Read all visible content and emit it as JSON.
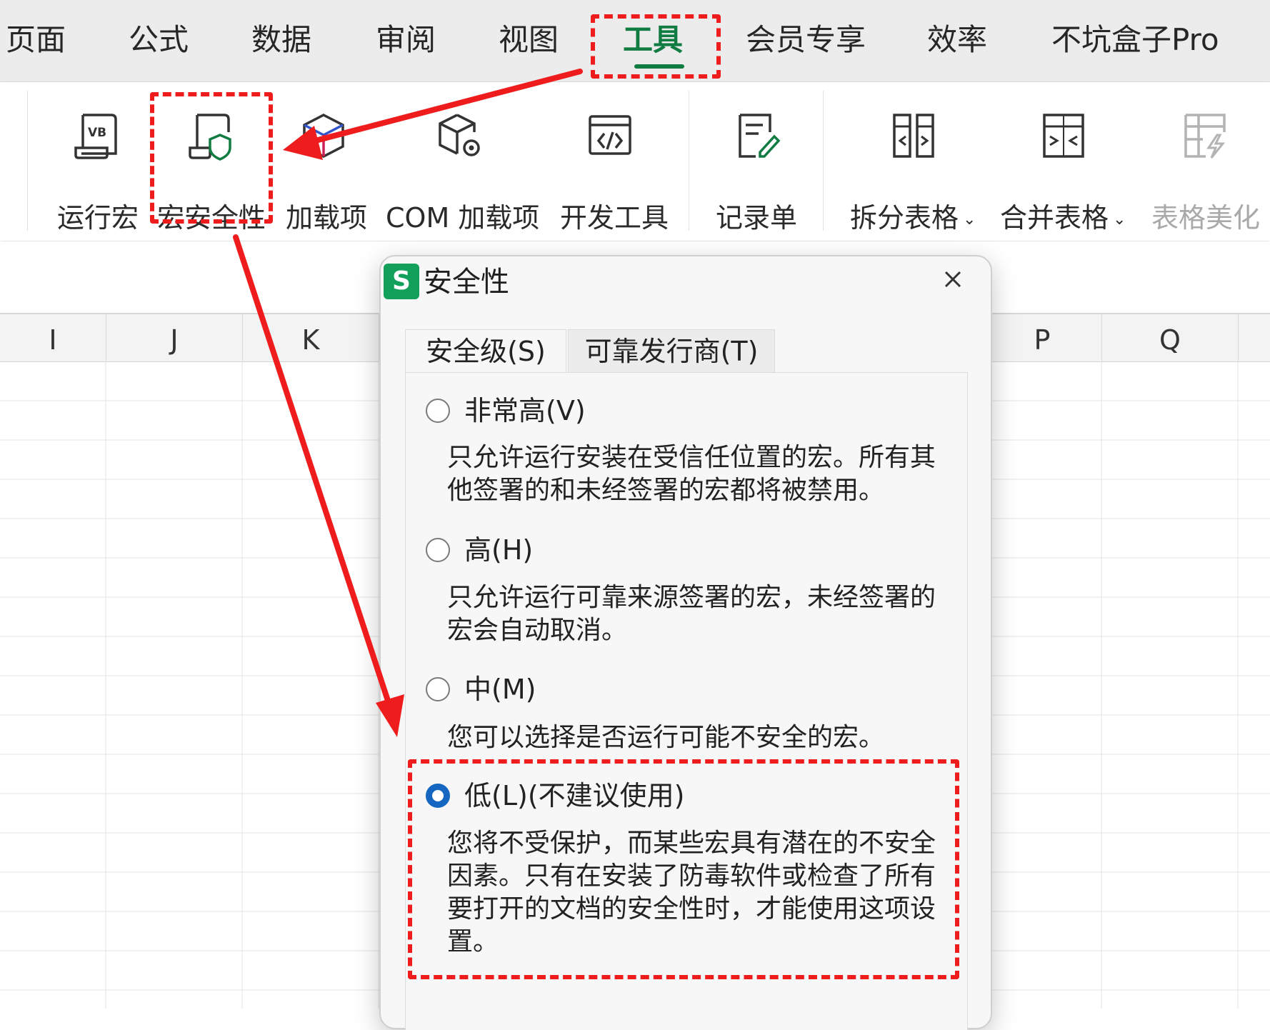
{
  "menu": {
    "items": [
      "页面",
      "公式",
      "数据",
      "审阅",
      "视图",
      "工具",
      "会员专享",
      "效率",
      "不坑盒子Pro"
    ],
    "active": "工具"
  },
  "ribbon": {
    "run_macro": "运行宏",
    "macro_security": "宏安全性",
    "addins": "加载项",
    "com_addins": "COM 加载项",
    "dev_tools": "开发工具",
    "record_sheet": "记录单",
    "split_table": "拆分表格",
    "merge_table": "合并表格",
    "beautify_table": "表格美化",
    "vb_badge": "VB"
  },
  "sheet": {
    "columns": [
      "I",
      "J",
      "K",
      "P",
      "Q"
    ]
  },
  "dialog": {
    "logo": "S",
    "title": "安全性",
    "tabs": [
      "安全级(S)",
      "可靠发行商(T)"
    ],
    "options": [
      {
        "label": "非常高(V)",
        "desc": "只允许运行安装在受信任位置的宏。所有其他签署的和未经签署的宏都将被禁用。",
        "checked": false
      },
      {
        "label": "高(H)",
        "desc": "只允许运行可靠来源签署的宏，未经签署的宏会自动取消。",
        "checked": false
      },
      {
        "label": "中(M)",
        "desc": "您可以选择是否运行可能不安全的宏。",
        "checked": false
      },
      {
        "label": "低(L)(不建议使用)",
        "desc": "您将不受保护，而某些宏具有潜在的不安全因素。只有在安装了防毒软件或检查了所有要打开的文档的安全性时，才能使用这项设置。",
        "checked": true
      }
    ]
  },
  "colors": {
    "accent_green": "#107c41",
    "annotation_red": "#ee1c1c",
    "radio_blue": "#1466c0"
  }
}
